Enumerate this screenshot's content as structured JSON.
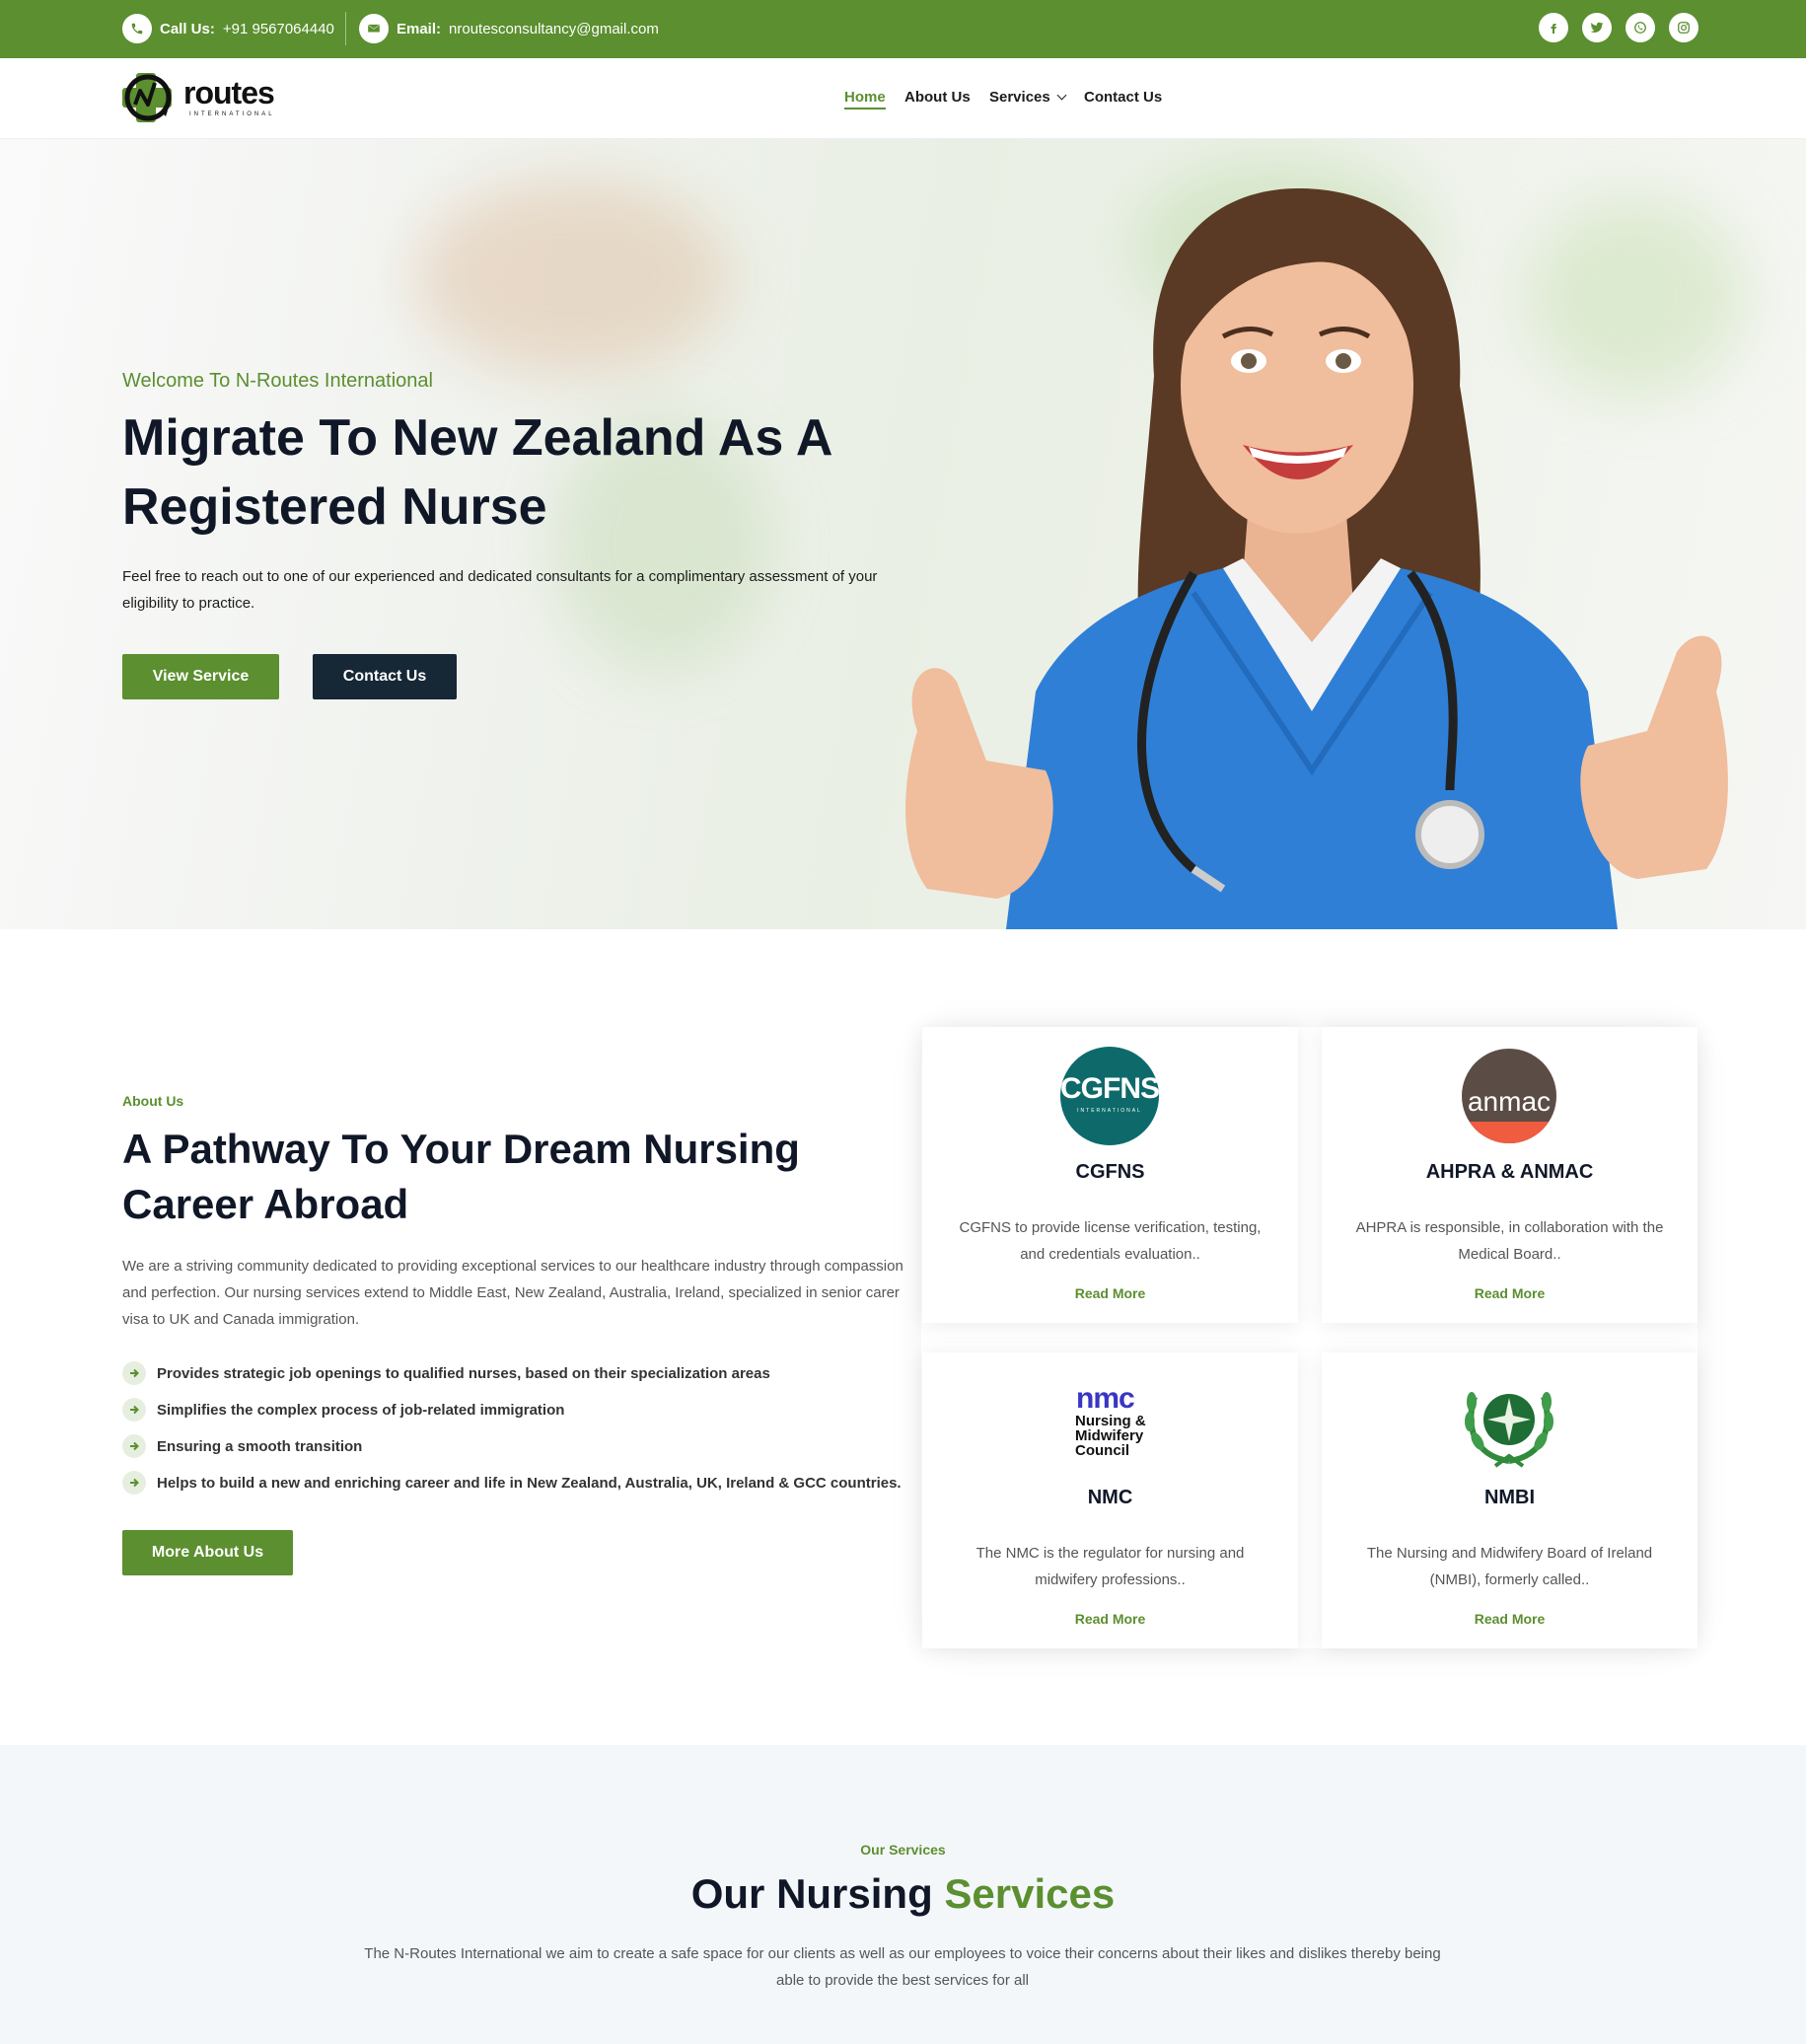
{
  "topbar": {
    "call_label": "Call Us:",
    "phone": "+91 9567064440",
    "email_label": "Email:",
    "email": "nroutesconsultancy@gmail.com",
    "social": [
      "facebook-icon",
      "twitter-icon",
      "whatsapp-icon",
      "instagram-icon"
    ]
  },
  "header": {
    "logo_text": "routes",
    "logo_sub": "INTERNATIONAL",
    "nav": [
      {
        "label": "Home",
        "active": true
      },
      {
        "label": "About Us"
      },
      {
        "label": "Services"
      },
      {
        "label": "Contact Us"
      }
    ]
  },
  "hero": {
    "subtitle": "Welcome To N-Routes International",
    "title": "Migrate To New Zealand As A Registered Nurse",
    "description": "Feel free to reach out to one of our experienced and dedicated consultants for a complimentary assessment of your eligibility to practice.",
    "btn_service": "View Service",
    "btn_contact": "Contact Us"
  },
  "about": {
    "tag": "About Us",
    "title": "A Pathway To Your Dream Nursing Career Abroad",
    "description": "We are a striving community dedicated to providing exceptional services to our healthcare industry through compassion and perfection. Our nursing services extend to Middle East, New Zealand, Australia, Ireland, specialized in senior carer visa to UK and Canada immigration.",
    "points": [
      "Provides strategic job openings to qualified nurses, based on their specialization areas",
      "Simplifies the complex process of job-related immigration",
      "Ensuring a smooth transition",
      "Helps to build a new and enriching career and life in New Zealand, Australia, UK, Ireland & GCC countries."
    ],
    "button": "More About Us"
  },
  "cards": [
    {
      "logo_text": "CGFNS",
      "logo_sub": "INTERNATIONAL",
      "title": "CGFNS",
      "desc": "CGFNS to provide license verification, testing, and credentials evaluation..",
      "link": "Read More"
    },
    {
      "logo_text": "anmac",
      "title": "AHPRA & ANMAC",
      "desc": "AHPRA is responsible, in collaboration with the Medical Board..",
      "link": "Read More"
    },
    {
      "logo_text": "nmc",
      "logo_sub": "Nursing & Midwifery Council",
      "title": "NMC",
      "desc": "The NMC is the regulator for nursing and midwifery professions..",
      "link": "Read More"
    },
    {
      "title": "NMBI",
      "desc": "The Nursing and Midwifery Board of Ireland (NMBI), formerly called..",
      "link": "Read More"
    }
  ],
  "services": {
    "tag": "Our Services",
    "title_a": "Our Nursing",
    "title_b": "Services",
    "description": "The N-Routes International we aim to create a safe space for our clients as well as our employees to voice their concerns about their likes and dislikes thereby being able to provide the best services for all"
  },
  "colors": {
    "brand_green": "#5b8f2f",
    "dark_navy": "#162736",
    "title_dark": "#101828"
  }
}
